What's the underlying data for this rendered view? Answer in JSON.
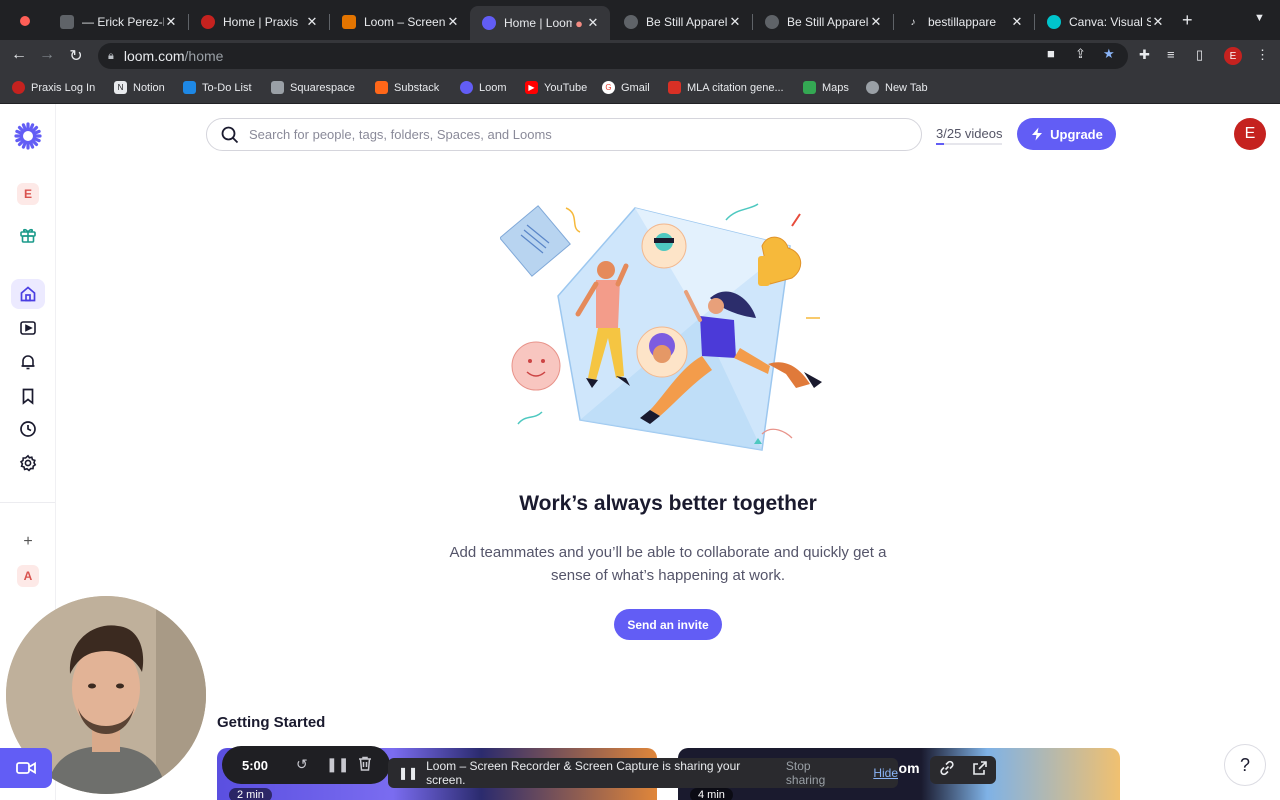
{
  "browser": {
    "tabs": [
      {
        "title": "— Erick Perez-N",
        "favicon_color": "#5f6368"
      },
      {
        "title": "Home | Praxis",
        "favicon_color": "#c5221f"
      },
      {
        "title": "Loom – Screen",
        "favicon_color": "#e37400"
      },
      {
        "title": "Home | Loom",
        "favicon_color": "#625df5",
        "active": true
      },
      {
        "title": "Be Still Apparel",
        "favicon_color": "#5f6368"
      },
      {
        "title": "Be Still Apparel-",
        "favicon_color": "#5f6368"
      },
      {
        "title": "bestillappare",
        "favicon_color": "#e8eaed"
      },
      {
        "title": "Canva: Visual S",
        "favicon_color": "#00c4cc"
      }
    ],
    "url_host": "loom.com",
    "url_path": "/home",
    "profile_initial": "E",
    "bookmarks": [
      {
        "label": "Praxis Log In",
        "color": "#c5221f"
      },
      {
        "label": "Notion",
        "color": "#e8eaed"
      },
      {
        "label": "To-Do List",
        "color": "#1e88e5"
      },
      {
        "label": "Squarespace",
        "color": "#9aa0a6"
      },
      {
        "label": "Substack",
        "color": "#ff6719"
      },
      {
        "label": "Loom",
        "color": "#625df5"
      },
      {
        "label": "YouTube",
        "color": "#ff0000"
      },
      {
        "label": "Gmail",
        "color": "#ea4335"
      },
      {
        "label": "MLA citation gene...",
        "color": "#d93025"
      },
      {
        "label": "Maps",
        "color": "#34a853"
      },
      {
        "label": "New Tab",
        "color": "#9aa0a6"
      }
    ]
  },
  "sidebar": {
    "workspace_initial": "E",
    "space_initial": "A",
    "add_label": "+"
  },
  "header": {
    "search_placeholder": "Search for people, tags, folders, Spaces, and Looms",
    "video_count": "3/25 videos",
    "video_usage_fraction": 0.12,
    "upgrade_label": "Upgrade",
    "user_initial": "E"
  },
  "main": {
    "headline": "Work’s always better together",
    "subtext": "Add teammates and you’ll be able to collaborate and quickly get a sense of what’s happening at work.",
    "invite_label": "Send an invite",
    "section_title": "Getting Started",
    "cards": [
      {
        "duration": "2 min"
      },
      {
        "duration": "4 min",
        "brand": "oom"
      }
    ]
  },
  "recorder": {
    "timer": "5:00",
    "share_message": "Loom – Screen Recorder & Screen Capture is sharing your screen.",
    "stop_label": "Stop sharing",
    "hide_label": "Hide"
  },
  "help_label": "?",
  "colors": {
    "accent": "#625df5",
    "avatar": "#c5221f"
  }
}
